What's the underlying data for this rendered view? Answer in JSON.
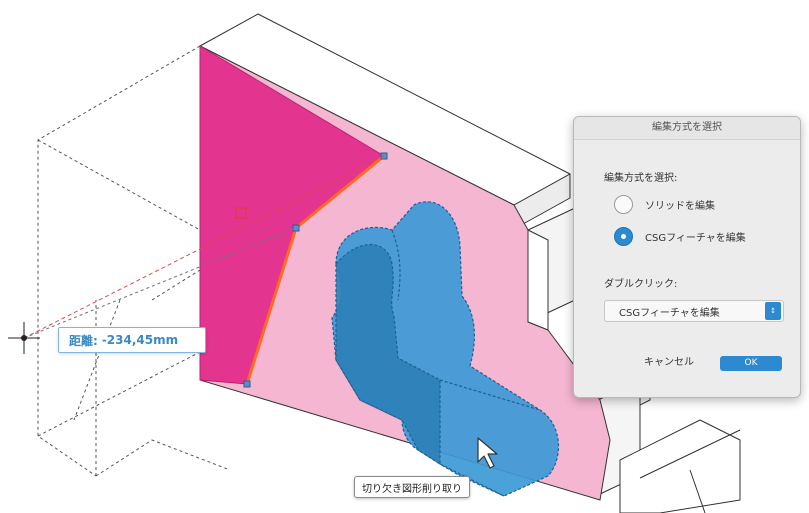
{
  "measurement": {
    "label": "距離:",
    "value": "-234,45mm"
  },
  "tooltip": {
    "text": "切り欠き図形削り取り"
  },
  "dialog": {
    "title": "編集方式を選択",
    "edit_mode_label": "編集方式を選択:",
    "options": [
      {
        "label": "ソリッドを編集",
        "selected": false
      },
      {
        "label": "CSGフィーチャを編集",
        "selected": true
      }
    ],
    "double_click_label": "ダブルクリック:",
    "double_click_value": "CSGフィーチャを編集",
    "cancel_label": "キャンセル",
    "ok_label": "OK"
  },
  "colors": {
    "magenta_face": "#e3348f",
    "pink_face": "#f4b6d1",
    "blue_feature": "#3c9ad6",
    "highlight_edge": "#ff6a1f",
    "accent": "#2d8ad0"
  }
}
